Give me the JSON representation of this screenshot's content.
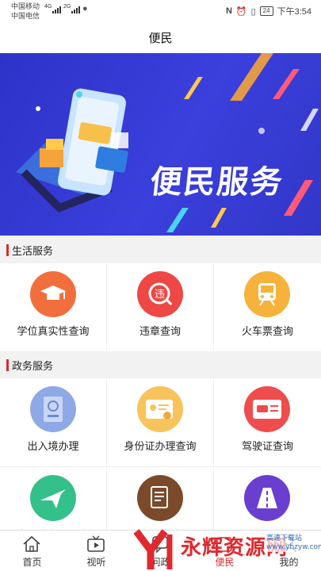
{
  "status_bar": {
    "carrier1": "中国移动",
    "carrier1_signal": "4G",
    "carrier2": "中国电信",
    "carrier2_signal": "2G",
    "battery": "24",
    "time": "下午3:54"
  },
  "title": "便民",
  "banner": {
    "title": "便民服务"
  },
  "sections": [
    {
      "title": "生活服务",
      "items": [
        {
          "label": "学位真实性查询",
          "color": "#f26f3d",
          "icon": "graduation-cap-icon"
        },
        {
          "label": "违章查询",
          "color": "#ee4744",
          "icon": "traffic-violation-icon"
        },
        {
          "label": "火车票查询",
          "color": "#f7b23b",
          "icon": "train-icon"
        }
      ]
    },
    {
      "title": "政务服务",
      "items": [
        {
          "label": "出入境办理",
          "color": "#8fa8e6",
          "icon": "passport-icon"
        },
        {
          "label": "身份证办理查询",
          "color": "#f7c45c",
          "icon": "id-card-icon"
        },
        {
          "label": "驾驶证查询",
          "color": "#ef4d4d",
          "icon": "driver-license-icon"
        },
        {
          "label": "出入境办理进度",
          "color": "#34c08a",
          "icon": "airplane-icon"
        },
        {
          "label": "个税缴纳",
          "color": "#7a4a2a",
          "icon": "tax-document-icon"
        },
        {
          "label": "高速路况查询",
          "color": "#6a3fcf",
          "icon": "highway-icon"
        }
      ]
    }
  ],
  "bottom_nav": [
    {
      "label": "首页",
      "icon": "home-icon"
    },
    {
      "label": "视听",
      "icon": "tv-icon"
    },
    {
      "label": "问政",
      "icon": "chat-icon"
    },
    {
      "label": "便民",
      "icon": "service-icon"
    },
    {
      "label": "我的",
      "icon": "user-icon"
    }
  ],
  "watermark": {
    "text": "永辉资源网",
    "sub": "高速下载站 www.yhzyw.com"
  }
}
